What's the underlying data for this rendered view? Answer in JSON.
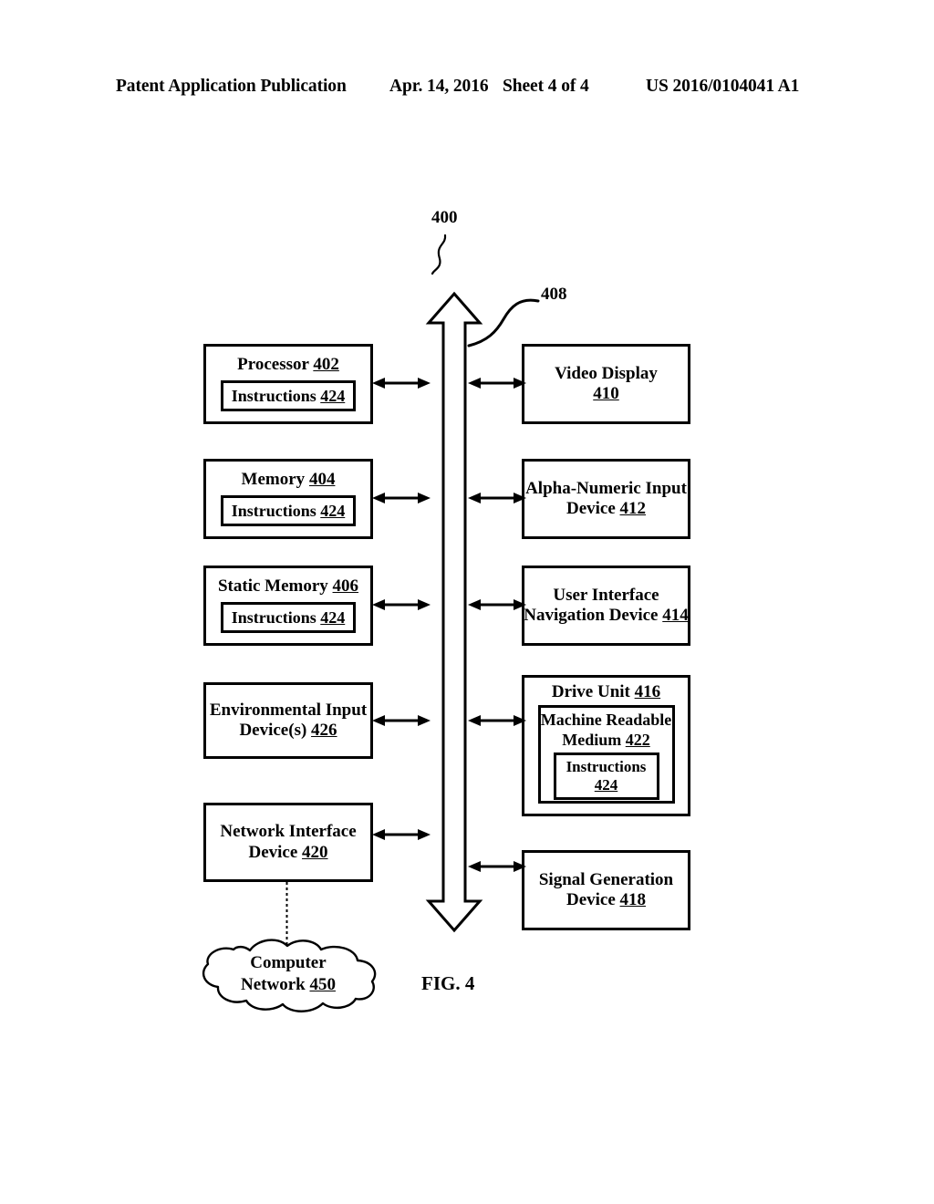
{
  "header": {
    "publication": "Patent Application Publication",
    "date": "Apr. 14, 2016",
    "sheet": "Sheet 4 of 4",
    "patent_number": "US 2016/0104041 A1"
  },
  "figure": {
    "caption": "FIG. 4",
    "system_label": "400",
    "bus_label": "408"
  },
  "left_column": [
    {
      "title": "Processor",
      "title_ref": "402",
      "nested": {
        "title": "Instructions",
        "title_ref": "424"
      }
    },
    {
      "title": "Memory",
      "title_ref": "404",
      "nested": {
        "title": "Instructions",
        "title_ref": "424"
      }
    },
    {
      "title": "Static Memory",
      "title_ref": "406",
      "nested": {
        "title": "Instructions",
        "title_ref": "424"
      }
    },
    {
      "line1": "Environmental Input",
      "line2": "Device(s)",
      "title_ref": "426"
    },
    {
      "line1": "Network Interface",
      "line2": "Device",
      "title_ref": "420"
    }
  ],
  "right_column": [
    {
      "line1": "Video Display",
      "title_ref": "410"
    },
    {
      "line1": "Alpha-Numeric Input",
      "line2": "Device",
      "title_ref": "412"
    },
    {
      "line1": "User Interface",
      "line2": "Navigation Device",
      "title_ref": "414"
    },
    {
      "title": "Drive Unit",
      "title_ref": "416",
      "nested": {
        "line1": "Machine Readable",
        "line2": "Medium",
        "title_ref": "422",
        "nested": {
          "title": "Instructions",
          "title_ref": "424"
        }
      }
    },
    {
      "line1": "Signal Generation",
      "line2": "Device",
      "title_ref": "418"
    }
  ],
  "network": {
    "line1": "Computer",
    "line2": "Network",
    "title_ref": "450"
  },
  "colors": {
    "ink": "#000000",
    "paper": "#ffffff"
  }
}
